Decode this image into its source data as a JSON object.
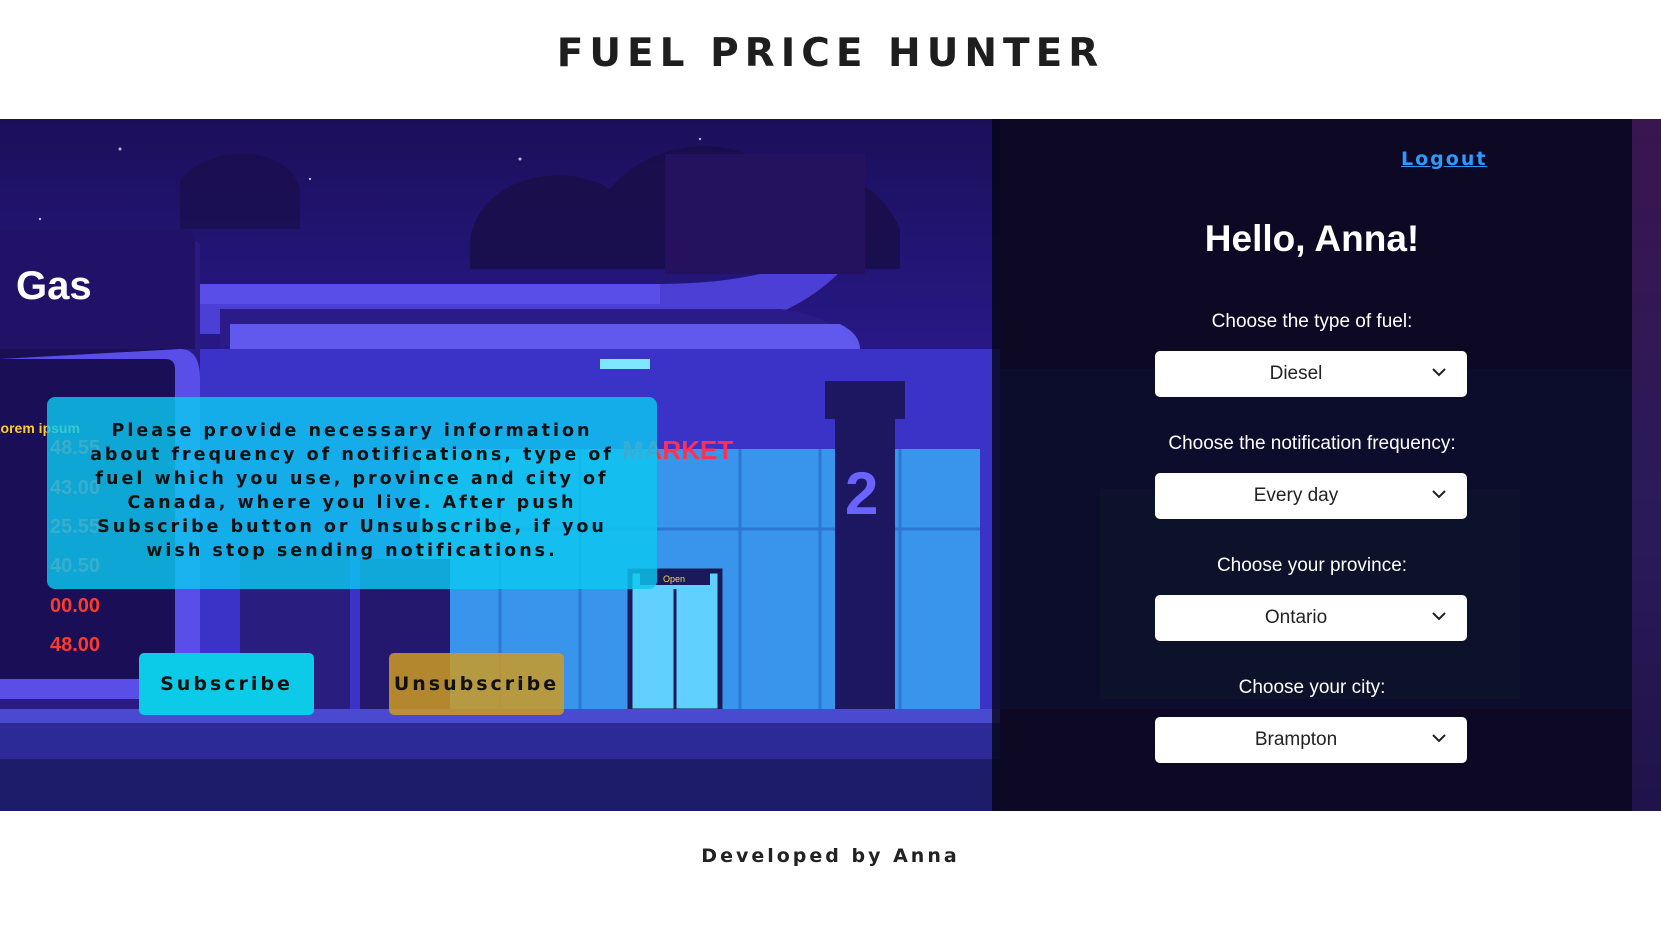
{
  "header": {
    "title": "FUEL PRICE HUNTER"
  },
  "hero": {
    "info_text": "Please provide necessary information about frequency of notifications, type of fuel which you use, province and city of Canada, where you live. After push Subscribe button or Unsubscribe, if you wish stop sending notifications.",
    "subscribe_label": "Subscribe",
    "unsubscribe_label": "Unsubscribe",
    "background": {
      "sign_text": "Gas",
      "lorem_text": "Lorem ipsum",
      "prices": [
        "48.55",
        "43.00",
        "25.55",
        "40.50",
        "00.00",
        "48.00"
      ],
      "market_text": "MARKET",
      "pump_number": "2",
      "door_text": "Open"
    }
  },
  "panel": {
    "logout_label": "Logout",
    "greeting": "Hello, Anna!",
    "fields": [
      {
        "label": "Choose the type of fuel:",
        "value": "Diesel"
      },
      {
        "label": "Choose the notification frequency:",
        "value": "Every day"
      },
      {
        "label": "Choose your province:",
        "value": "Ontario"
      },
      {
        "label": "Choose your city:",
        "value": "Brampton"
      }
    ]
  },
  "footer": {
    "text": "Developed by Anna"
  },
  "colors": {
    "link": "#2b9bff",
    "subscribe": "#0ccbe8",
    "unsubscribe": "#cd9b23",
    "info_box": "#0cc8f0",
    "price_red": "#ff3a2a",
    "panel_bg": "#040412"
  }
}
